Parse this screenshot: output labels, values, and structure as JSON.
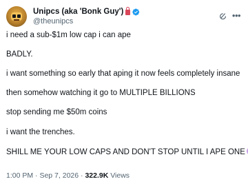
{
  "author": {
    "display_name": "Unipcs (aka 'Bonk Guy')",
    "handle": "@theunipcs"
  },
  "tweet": {
    "paragraphs": [
      "i need a sub-$1m low cap i can ape",
      "BADLY.",
      "i want something so early that aping it now feels completely insane",
      "then somehow watching it go to MULTIPLE BILLIONS",
      "stop sending me $50m coins",
      "i want the trenches.",
      "SHILL ME YOUR LOW CAPS AND DON'T STOP UNTIL I APE ONE"
    ]
  },
  "meta": {
    "time": "1:00 PM",
    "separator": "·",
    "date": "Sep 7, 2026",
    "views_count": "322.9K",
    "views_label": "Views"
  },
  "colors": {
    "verified": "#1d9bf0",
    "secondary_text": "#536471",
    "primary_text": "#0f1419"
  }
}
